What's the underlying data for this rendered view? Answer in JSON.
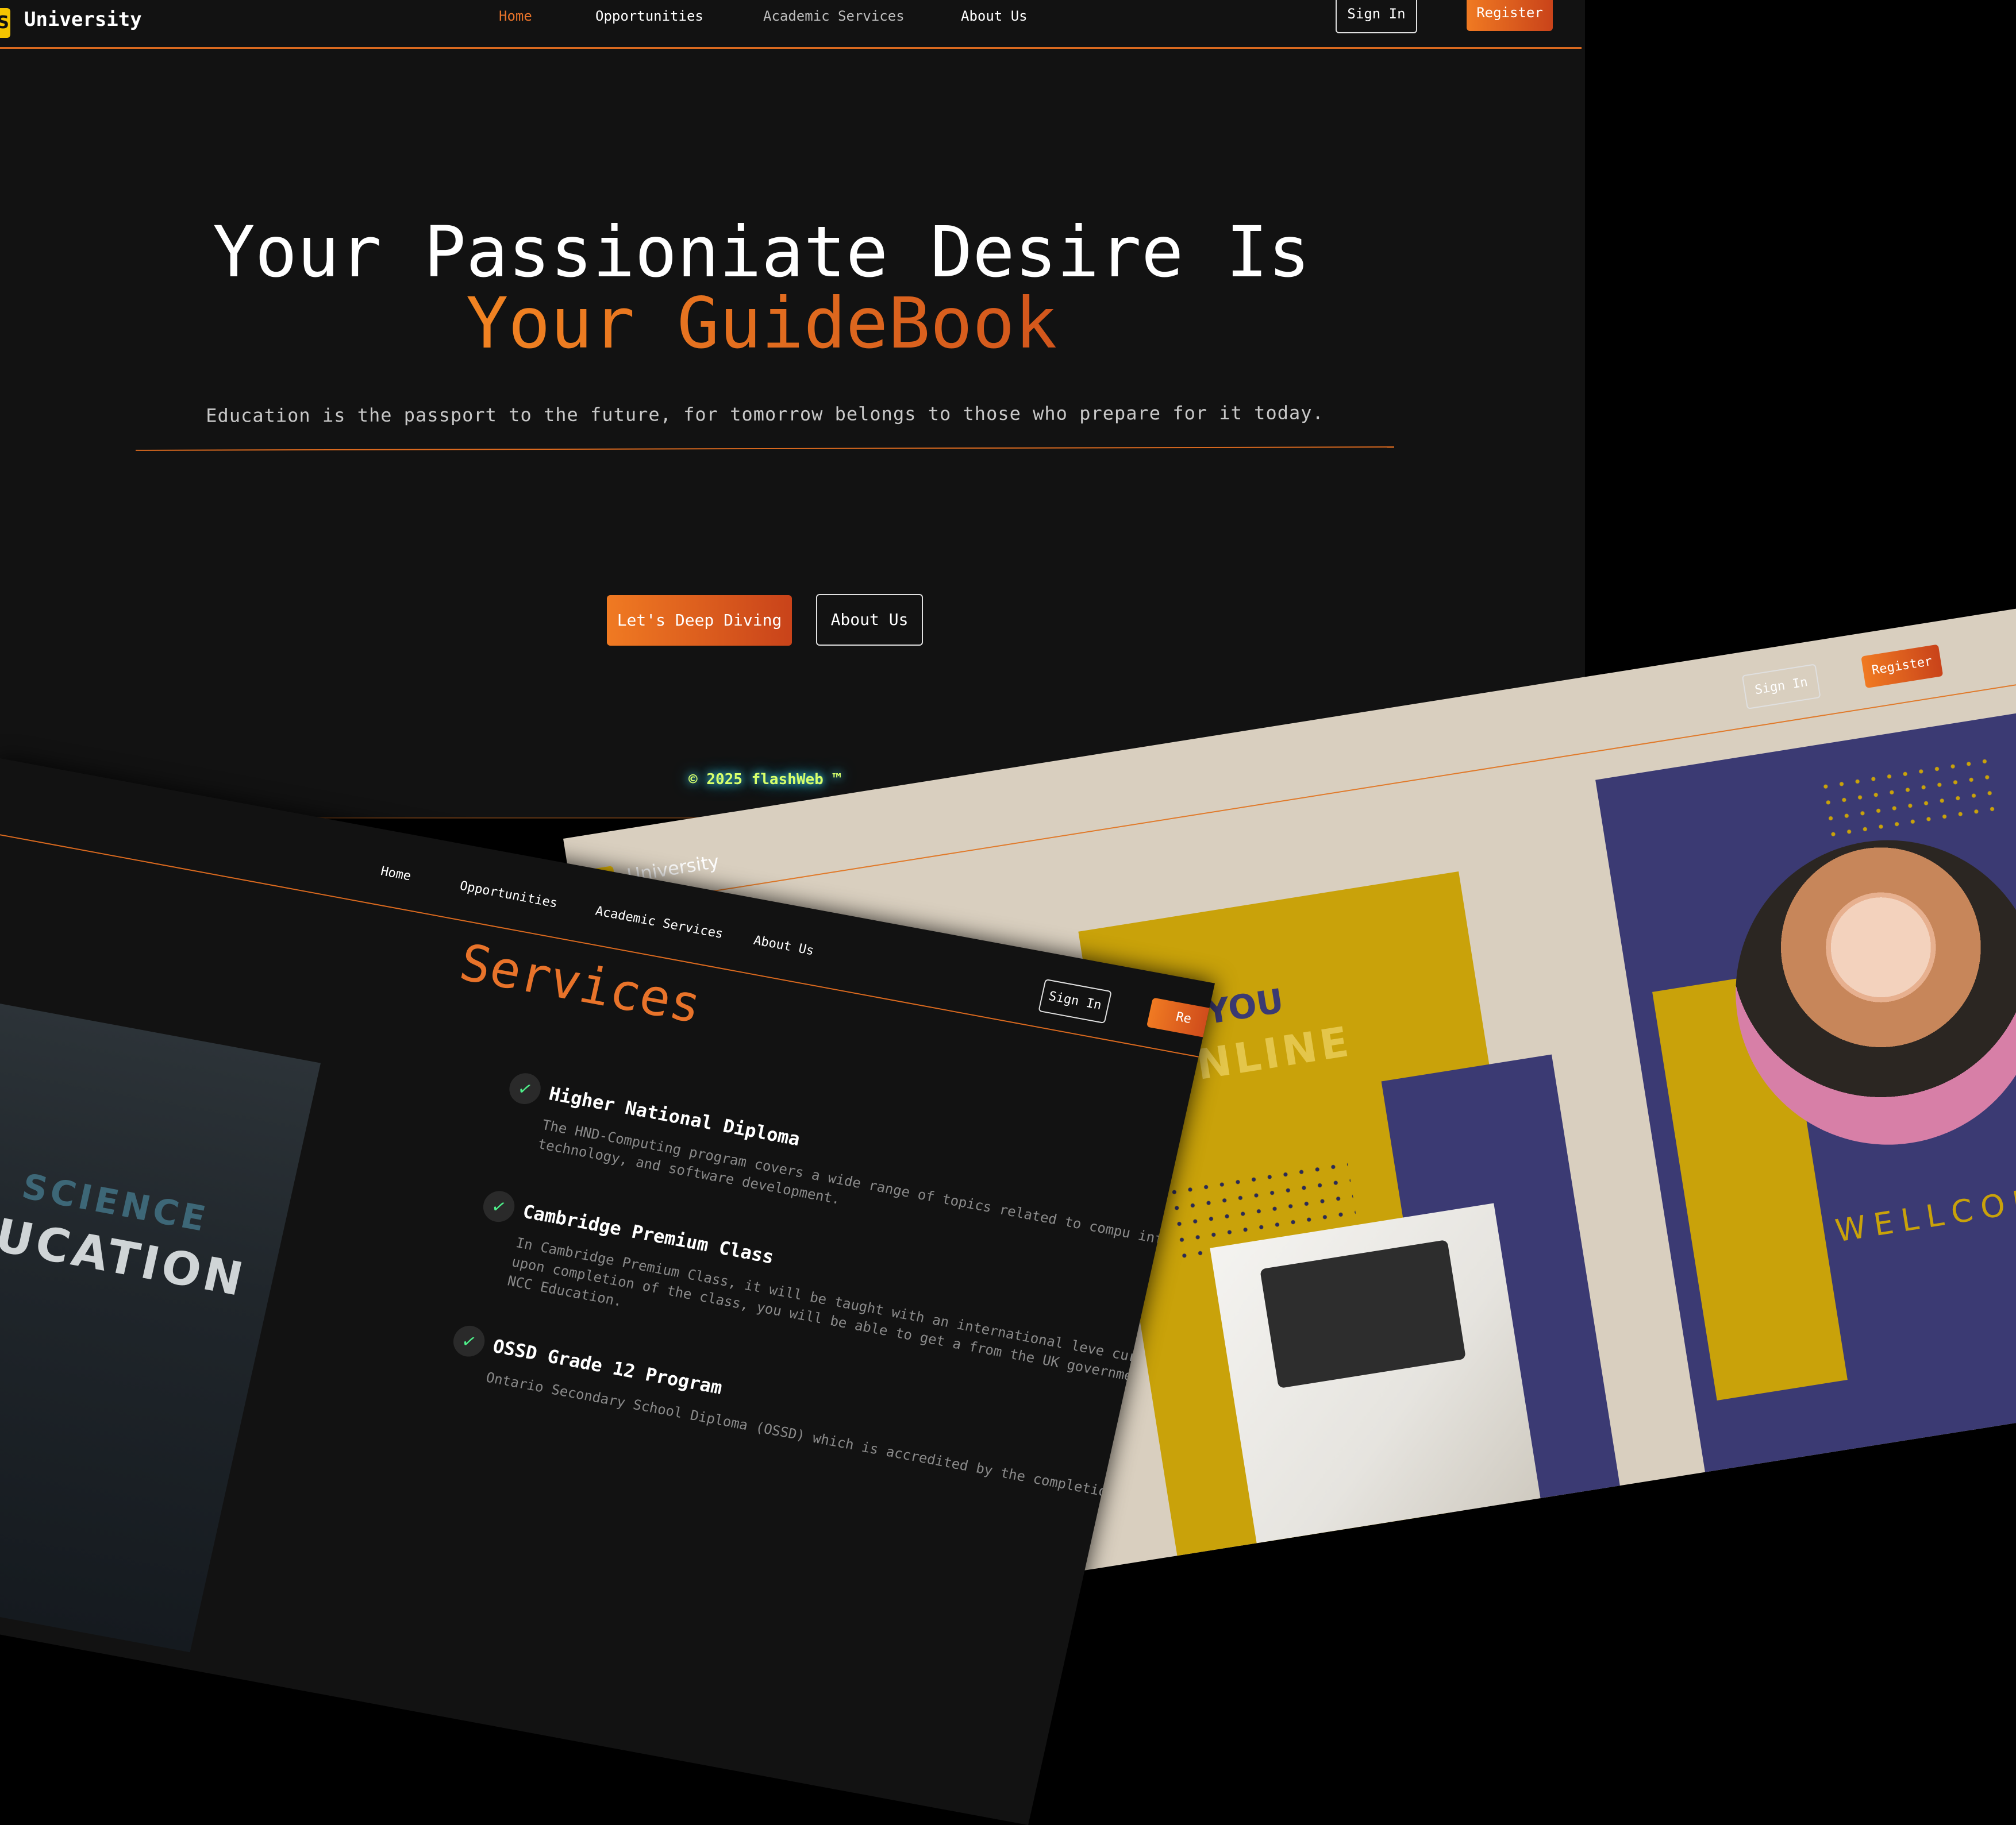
{
  "hero": {
    "logo_glyph": "S",
    "logo_text": "University",
    "nav": [
      "Home",
      "Opportunities",
      "Academic Services",
      "About Us"
    ],
    "sign_in": "Sign In",
    "register": "Register",
    "headline_line1": "Your Passioniate Desire Is",
    "headline_line2": "Your GuideBook",
    "tagline": "Education is the passport to the future, for tomorrow belongs to those who prepare for it today.",
    "cta_primary": "Let's Deep Diving",
    "cta_secondary": "About Us",
    "copyright": "© 2025 flashWeb ™"
  },
  "services_window": {
    "nav": [
      "Home",
      "Opportunities",
      "Academic Services",
      "About Us"
    ],
    "sign_in": "Sign In",
    "register_partial": "Re",
    "title": "Services",
    "image_text_main": "EDUCATION",
    "image_text_science": "SCIENCE",
    "items": [
      {
        "title": "Higher National Diploma",
        "desc": "The HND-Computing program covers a wide range of topics related to compu information technology, and software development."
      },
      {
        "title": "Cambridge Premium Class",
        "desc": "In Cambridge Premium Class, it will be taught with an international leve curriculum, and upon completion of the class, you will be able to get a from the UK government recognized NCC Education."
      },
      {
        "title": "OSSD Grade 12 Program",
        "desc": "Ontario Secondary School Diploma (OSSD) which is accredited by the completion"
      }
    ],
    "check_glyph": "✓"
  },
  "welcome_window": {
    "logo_text": "University",
    "sign_in": "Sign In",
    "register": "Register",
    "get_you": "GET YOU",
    "online": "ONLINE",
    "wellcome": "WELLCOME"
  },
  "colors": {
    "accent": "#e8732a",
    "background": "#121212",
    "gold": "#c9a20a",
    "indigo": "#3b3a73",
    "cream": "#d9cfbf"
  }
}
